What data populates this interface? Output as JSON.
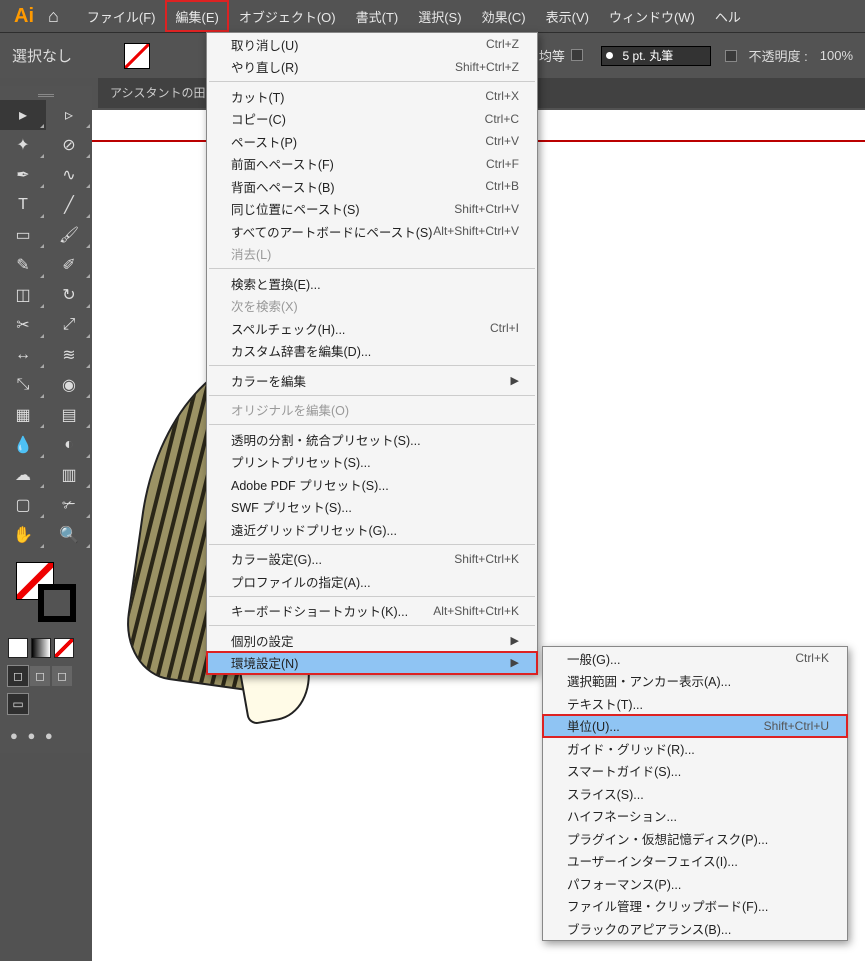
{
  "menubar": {
    "items": [
      "ファイル(F)",
      "編集(E)",
      "オブジェクト(O)",
      "書式(T)",
      "選択(S)",
      "効果(C)",
      "表示(V)",
      "ウィンドウ(W)",
      "ヘル"
    ]
  },
  "options": {
    "no_selection": "選択なし",
    "uniform": "均等",
    "stroke": "5 pt. 丸筆",
    "opacity_label": "不透明度 :",
    "opacity_value": "100%"
  },
  "doc_tab": "アシスタントの田",
  "edit_menu": [
    {
      "label": "取り消し(U)",
      "sc": "Ctrl+Z"
    },
    {
      "label": "やり直し(R)",
      "sc": "Shift+Ctrl+Z"
    },
    {
      "sep": true
    },
    {
      "label": "カット(T)",
      "sc": "Ctrl+X"
    },
    {
      "label": "コピー(C)",
      "sc": "Ctrl+C"
    },
    {
      "label": "ペースト(P)",
      "sc": "Ctrl+V"
    },
    {
      "label": "前面へペースト(F)",
      "sc": "Ctrl+F"
    },
    {
      "label": "背面へペースト(B)",
      "sc": "Ctrl+B"
    },
    {
      "label": "同じ位置にペースト(S)",
      "sc": "Shift+Ctrl+V"
    },
    {
      "label": "すべてのアートボードにペースト(S)",
      "sc": "Alt+Shift+Ctrl+V"
    },
    {
      "label": "消去(L)",
      "disabled": true
    },
    {
      "sep": true
    },
    {
      "label": "検索と置換(E)..."
    },
    {
      "label": "次を検索(X)",
      "disabled": true
    },
    {
      "label": "スペルチェック(H)...",
      "sc": "Ctrl+I"
    },
    {
      "label": "カスタム辞書を編集(D)..."
    },
    {
      "sep": true
    },
    {
      "label": "カラーを編集",
      "sub": true
    },
    {
      "sep": true
    },
    {
      "label": "オリジナルを編集(O)",
      "disabled": true
    },
    {
      "sep": true
    },
    {
      "label": "透明の分割・統合プリセット(S)..."
    },
    {
      "label": "プリントプリセット(S)..."
    },
    {
      "label": "Adobe PDF プリセット(S)..."
    },
    {
      "label": "SWF プリセット(S)..."
    },
    {
      "label": "遠近グリッドプリセット(G)..."
    },
    {
      "sep": true
    },
    {
      "label": "カラー設定(G)...",
      "sc": "Shift+Ctrl+K"
    },
    {
      "label": "プロファイルの指定(A)..."
    },
    {
      "sep": true
    },
    {
      "label": "キーボードショートカット(K)...",
      "sc": "Alt+Shift+Ctrl+K"
    },
    {
      "sep": true
    },
    {
      "label": "個別の設定",
      "sub": true
    },
    {
      "label": "環境設定(N)",
      "sub": true,
      "hl": true,
      "redbox": true
    }
  ],
  "pref_menu": [
    {
      "label": "一般(G)...",
      "sc": "Ctrl+K"
    },
    {
      "label": "選択範囲・アンカー表示(A)..."
    },
    {
      "label": "テキスト(T)..."
    },
    {
      "label": "単位(U)...",
      "sc": "Shift+Ctrl+U",
      "hlred": true
    },
    {
      "label": "ガイド・グリッド(R)..."
    },
    {
      "label": "スマートガイド(S)..."
    },
    {
      "label": "スライス(S)..."
    },
    {
      "label": "ハイフネーション..."
    },
    {
      "label": "プラグイン・仮想記憶ディスク(P)..."
    },
    {
      "label": "ユーザーインターフェイス(I)..."
    },
    {
      "label": "パフォーマンス(P)..."
    },
    {
      "label": "ファイル管理・クリップボード(F)..."
    },
    {
      "label": "ブラックのアピアランス(B)..."
    }
  ],
  "tools": [
    "select",
    "direct",
    "wand",
    "lasso",
    "pen",
    "curve",
    "type",
    "line",
    "rect",
    "brush",
    "shaper",
    "pencil",
    "eraser",
    "rotate",
    "scissors",
    "scale",
    "width",
    "warp",
    "free",
    "shape",
    "mesh",
    "gradient",
    "eyedrop",
    "blend",
    "symbol",
    "graph",
    "artboard",
    "slice",
    "hand",
    "zoom"
  ]
}
